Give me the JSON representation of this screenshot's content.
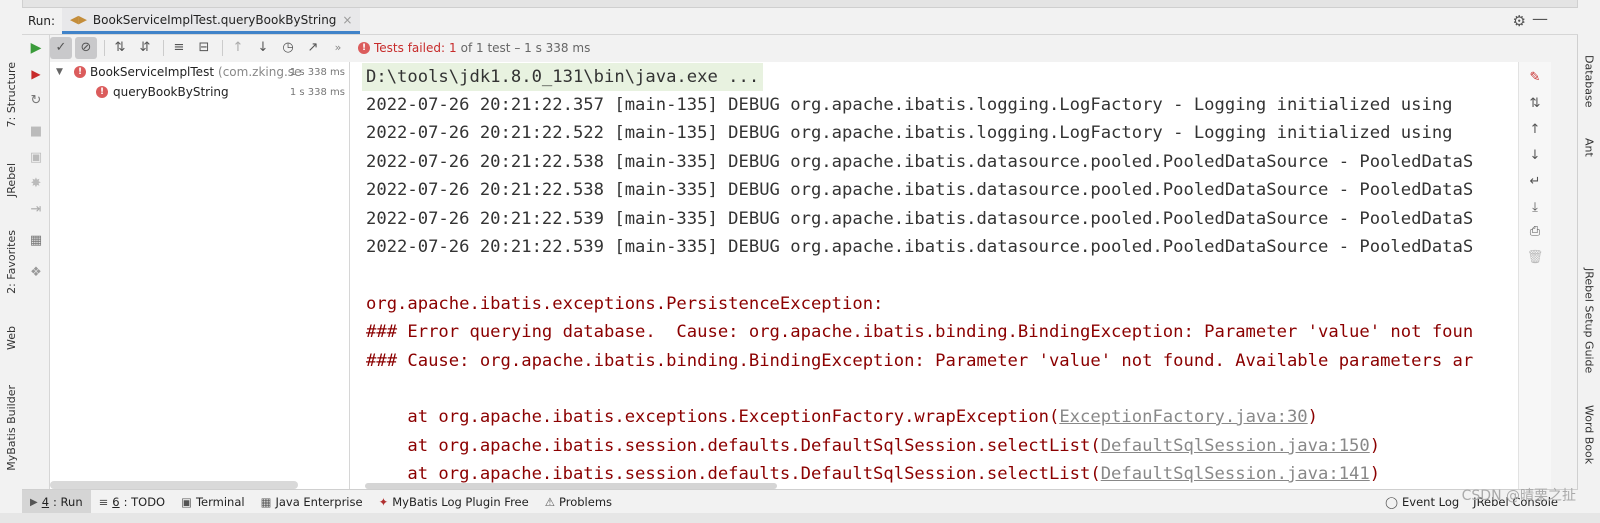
{
  "header": {
    "run_label": "Run:",
    "tab_title": "BookServiceImplTest.queryBookByString",
    "tab_close": "×"
  },
  "colors": {
    "accent": "#4083c9",
    "fail": "#c72b2b",
    "error_text": "#8b0000",
    "cmd_bg": "#e8f2e0"
  },
  "status": {
    "failed_label": "Tests failed:",
    "failed_count": "1",
    "summary": "of 1 test – 1 s 338 ms"
  },
  "tree": [
    {
      "name": "BookServiceImplTest",
      "pkg": "(com.zking.se",
      "duration": "1 s 338 ms"
    },
    {
      "name": "queryBookByString",
      "duration": "1 s 338 ms"
    }
  ],
  "console": {
    "command": "D:\\tools\\jdk1.8.0_131\\bin\\java.exe ...",
    "log_lines": [
      "2022-07-26 20:21:22.357 [main-135] DEBUG org.apache.ibatis.logging.LogFactory - Logging initialized using",
      "2022-07-26 20:21:22.522 [main-135] DEBUG org.apache.ibatis.logging.LogFactory - Logging initialized using",
      "2022-07-26 20:21:22.538 [main-335] DEBUG org.apache.ibatis.datasource.pooled.PooledDataSource - PooledDataS",
      "2022-07-26 20:21:22.538 [main-335] DEBUG org.apache.ibatis.datasource.pooled.PooledDataSource - PooledDataS",
      "2022-07-26 20:21:22.539 [main-335] DEBUG org.apache.ibatis.datasource.pooled.PooledDataSource - PooledDataS",
      "2022-07-26 20:21:22.539 [main-335] DEBUG org.apache.ibatis.datasource.pooled.PooledDataSource - PooledDataS"
    ],
    "error_lines": [
      "org.apache.ibatis.exceptions.PersistenceException:",
      "### Error querying database.  Cause: org.apache.ibatis.binding.BindingException: Parameter 'value' not foun",
      "### Cause: org.apache.ibatis.binding.BindingException: Parameter 'value' not found. Available parameters ar"
    ],
    "stack": [
      {
        "prefix": "    at org.apache.ibatis.exceptions.ExceptionFactory.wrapException(",
        "link": "ExceptionFactory.java:30",
        "suffix": ")"
      },
      {
        "prefix": "    at org.apache.ibatis.session.defaults.DefaultSqlSession.selectList(",
        "link": "DefaultSqlSession.java:150",
        "suffix": ")"
      },
      {
        "prefix": "    at org.apache.ibatis.session.defaults.DefaultSqlSession.selectList(",
        "link": "DefaultSqlSession.java:141",
        "suffix": ")"
      }
    ]
  },
  "left_tabs": [
    "7: Structure",
    "JRebel",
    "2: Favorites",
    "Web",
    "MyBatis Builder"
  ],
  "right_tabs": [
    "Database",
    "Ant",
    "JRebel Setup Guide",
    "Word Book"
  ],
  "bottom_tabs": {
    "run_num": "4",
    "run": ": Run",
    "todo_num": "6",
    "todo": ": TODO",
    "terminal": "Terminal",
    "java_enterprise": "Java Enterprise",
    "mybatis_log": "MyBatis Log Plugin Free",
    "problems": "Problems",
    "event_log": "Event Log",
    "jrebel_console": "JRebel Console"
  },
  "watermark": "CSDN @晴栗之扯"
}
